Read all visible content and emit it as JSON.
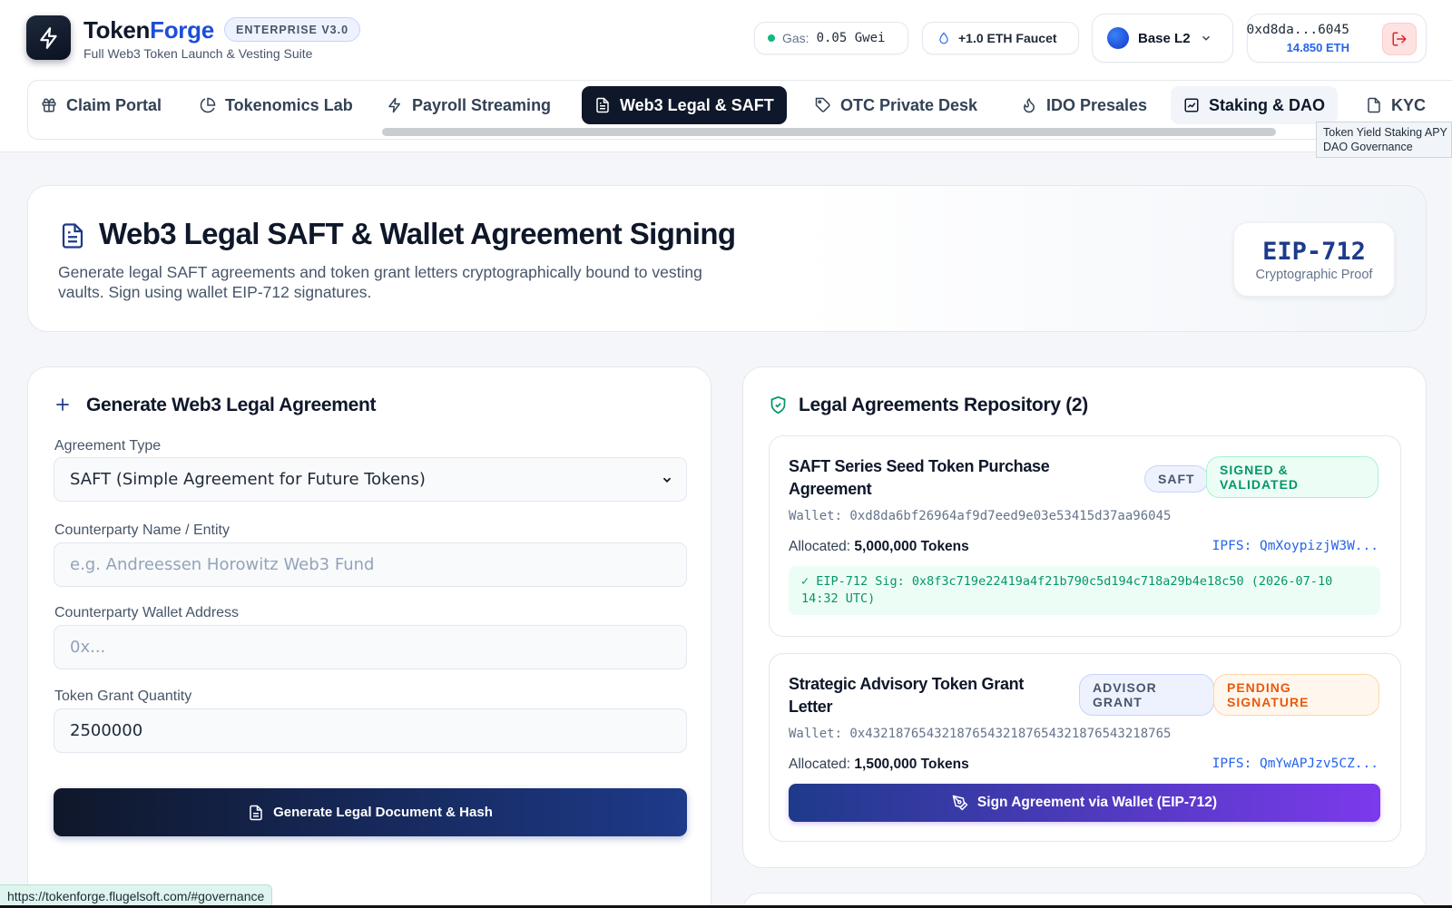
{
  "brand": {
    "name_part1": "Token",
    "name_part2": "Forge",
    "edition": "ENTERPRISE V3.0",
    "tagline": "Full Web3 Token Launch & Vesting Suite"
  },
  "topbar": {
    "gas_label": "Gas:",
    "gas_value": "0.05 Gwei",
    "faucet_label": "+1.0 ETH Faucet",
    "network": "Base L2",
    "account_address": "0xd8da...6045",
    "account_balance": "14.850 ETH"
  },
  "tabs": [
    {
      "label": "Claim Portal",
      "icon": "gift-icon"
    },
    {
      "label": "Tokenomics Lab",
      "icon": "pie-chart-icon"
    },
    {
      "label": "Payroll Streaming",
      "icon": "lightning-icon"
    },
    {
      "label": "Web3 Legal & SAFT",
      "icon": "document-icon",
      "active": true
    },
    {
      "label": "OTC Private Desk",
      "icon": "tag-icon"
    },
    {
      "label": "IDO Presales",
      "icon": "flame-icon"
    },
    {
      "label": "Staking & DAO",
      "icon": "chart-box-icon",
      "hovered": true
    },
    {
      "label": "KYC",
      "icon": "document-icon"
    }
  ],
  "tooltip": {
    "line1": "Token Yield Staking APY",
    "line2": "DAO Governance"
  },
  "hero": {
    "title": "Web3 Legal SAFT & Wallet Agreement Signing",
    "description": "Generate legal SAFT agreements and token grant letters cryptographically bound to vesting vaults. Sign using wallet EIP-712 signatures.",
    "proof_standard": "EIP-712",
    "proof_label": "Cryptographic Proof"
  },
  "form": {
    "title": "Generate Web3 Legal Agreement",
    "agreement_type_label": "Agreement Type",
    "agreement_type_value": "SAFT (Simple Agreement for Future Tokens)",
    "counterparty_name_label": "Counterparty Name / Entity",
    "counterparty_name_placeholder": "e.g. Andreessen Horowitz Web3 Fund",
    "counterparty_wallet_label": "Counterparty Wallet Address",
    "counterparty_wallet_placeholder": "0x...",
    "grant_quantity_label": "Token Grant Quantity",
    "grant_quantity_value": "2500000",
    "submit_label": "Generate Legal Document & Hash"
  },
  "repository": {
    "title": "Legal Agreements Repository (2)",
    "agreements": [
      {
        "title": "SAFT Series Seed Token Purchase Agreement",
        "type_badge": "SAFT",
        "status_badge": "SIGNED & VALIDATED",
        "wallet": "Wallet: 0xd8da6bf26964af9d7eed9e03e53415d37aa96045",
        "allocated_label": "Allocated:",
        "allocated_value": "5,000,000 Tokens",
        "ipfs": "IPFS: QmXoypizjW3W...",
        "signature": "✓ EIP-712 Sig: 0x8f3c719e22419a4f21b790c5d194c718a29b4e18c50 (2026-07-10 14:32 UTC)"
      },
      {
        "title": "Strategic Advisory Token Grant Letter",
        "type_badge": "ADVISOR GRANT",
        "status_badge": "PENDING SIGNATURE",
        "wallet": "Wallet: 0x4321876543218765432187654321876543218765",
        "allocated_label": "Allocated:",
        "allocated_value": "1,500,000 Tokens",
        "ipfs": "IPFS: QmYwAPJzv5CZ...",
        "sign_button": "Sign Agreement via Wallet (EIP-712)"
      }
    ]
  },
  "statusbar": {
    "url": "https://tokenforge.flugelsoft.com/#governance"
  }
}
